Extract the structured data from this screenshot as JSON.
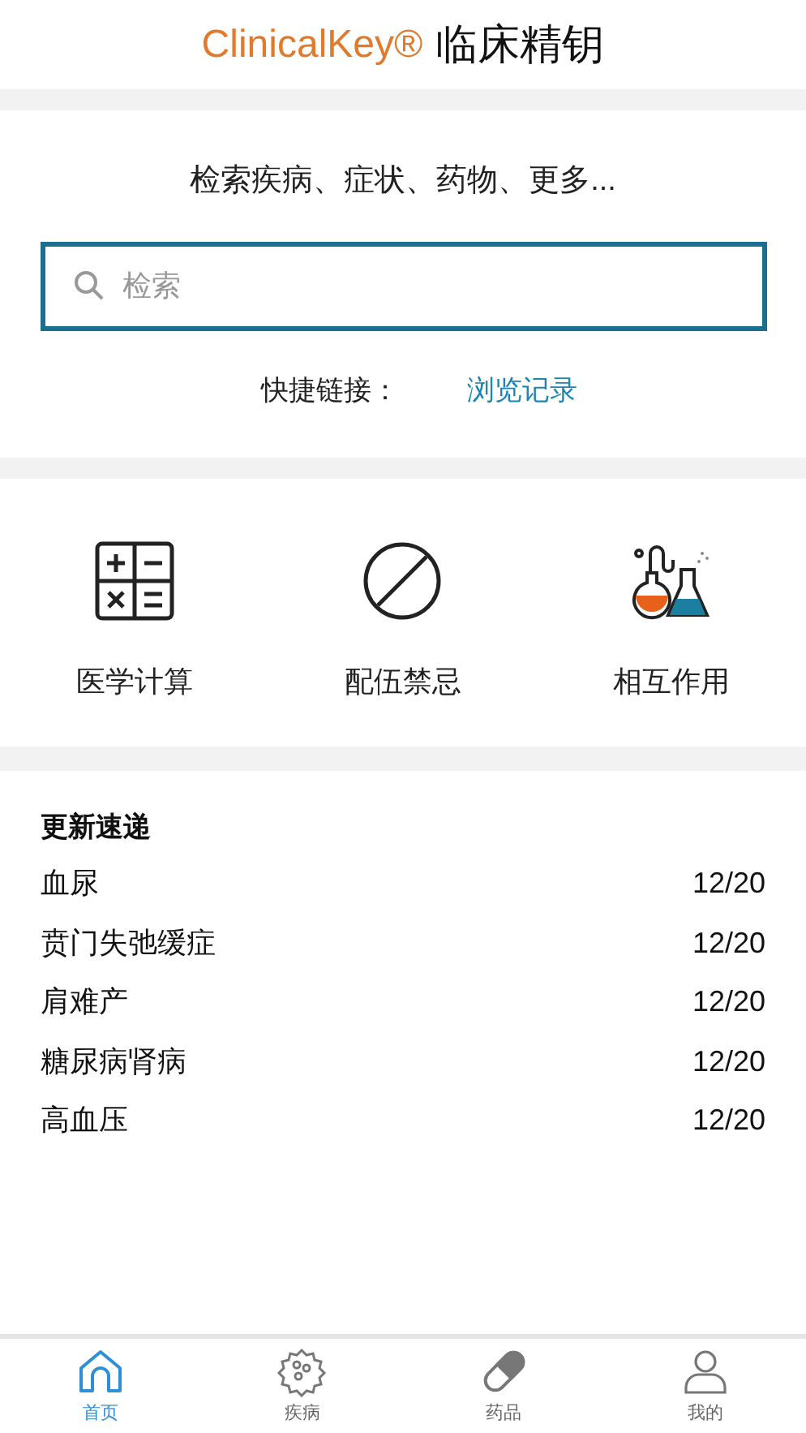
{
  "header": {
    "brand": "ClinicalKey®",
    "title": "临床精钥"
  },
  "search": {
    "heading": "检索疾病、症状、药物、更多...",
    "placeholder": "检索",
    "quick_links_label": "快捷链接：",
    "quick_links": [
      "浏览记录"
    ]
  },
  "tools": [
    {
      "kind": "calculator",
      "label": "医学计算"
    },
    {
      "kind": "prohibited",
      "label": "配伍禁忌"
    },
    {
      "kind": "flasks",
      "label": "相互作用"
    }
  ],
  "updates": {
    "title": "更新速递",
    "items": [
      {
        "name": "血尿",
        "date": "12/20"
      },
      {
        "name": "贲门失弛缓症",
        "date": "12/20"
      },
      {
        "name": "肩难产",
        "date": "12/20"
      },
      {
        "name": "糖尿病肾病",
        "date": "12/20"
      },
      {
        "name": "高血压",
        "date": "12/20"
      }
    ]
  },
  "tab_bar": [
    {
      "kind": "home",
      "label": "首页",
      "selected": true
    },
    {
      "kind": "germ",
      "label": "疾病",
      "selected": false
    },
    {
      "kind": "pill",
      "label": "药品",
      "selected": false
    },
    {
      "kind": "person",
      "label": "我的",
      "selected": false
    }
  ]
}
